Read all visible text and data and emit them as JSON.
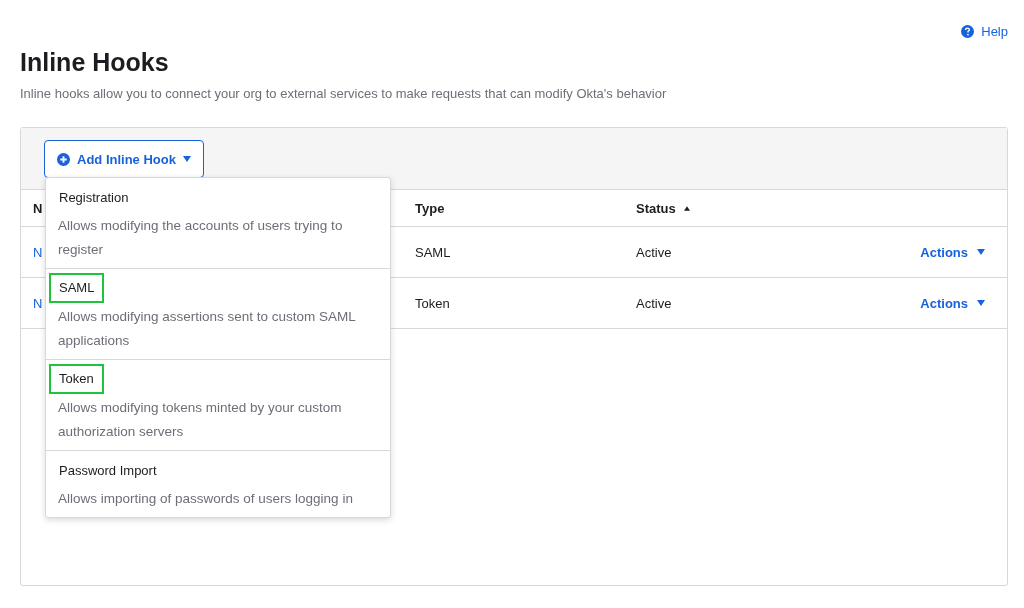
{
  "help_link": "Help",
  "page": {
    "title": "Inline Hooks",
    "description": "Inline hooks allow you to connect your org to external services to make requests that can modify Okta's behavior"
  },
  "add_button": {
    "label": "Add Inline Hook",
    "expanded": true
  },
  "menu": [
    {
      "title": "Registration",
      "description": "Allows modifying the accounts of users trying to register",
      "highlighted": false
    },
    {
      "title": "SAML",
      "description": "Allows modifying assertions sent to custom SAML applications",
      "highlighted": true
    },
    {
      "title": "Token",
      "description": "Allows modifying tokens minted by your custom authorization servers",
      "highlighted": true
    },
    {
      "title": "Password Import",
      "description": "Allows importing of passwords of users logging in",
      "highlighted": false
    }
  ],
  "table": {
    "columns": [
      {
        "label": "N",
        "sorted_ascending": false
      },
      {
        "label": "Type",
        "sorted_ascending": false
      },
      {
        "label": "Status",
        "sorted_ascending": true
      }
    ],
    "rows": [
      {
        "name": "N",
        "type": "SAML",
        "status": "Active",
        "action": "Actions"
      },
      {
        "name": "N",
        "type": "Token",
        "status": "Active",
        "action": "Actions"
      }
    ]
  }
}
